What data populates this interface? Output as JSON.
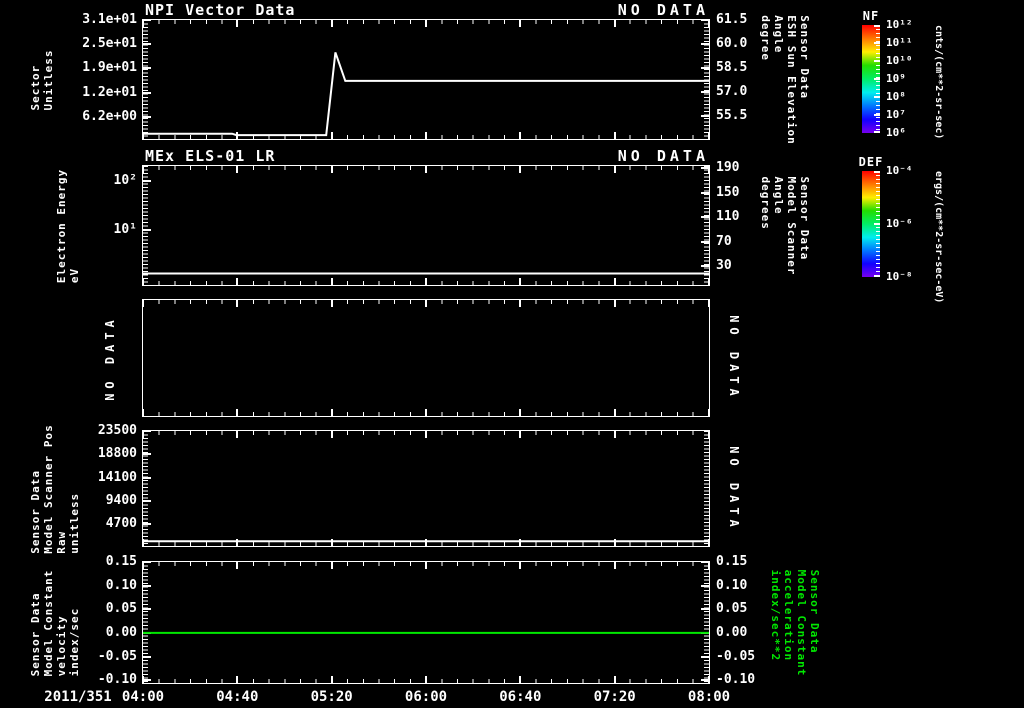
{
  "figure": {
    "background": "#000000",
    "foreground": "#ffffff",
    "accent_green": "#00e800"
  },
  "xaxis": {
    "date_label": "2011/351",
    "labels": [
      "04:00",
      "04:40",
      "05:20",
      "06:00",
      "06:40",
      "07:20",
      "08:00"
    ],
    "start_hour": 4,
    "end_hour": 8
  },
  "chart_data": [
    {
      "type": "line",
      "title": "NPI Vector Data",
      "status": "NO DATA",
      "left_label_lines": [
        "Sector",
        "Unitless"
      ],
      "right_label_lines": [
        "Sensor Data",
        "ESH Sun Elevation",
        "Angle",
        "degree"
      ],
      "y_rulers": true,
      "left_axis": {
        "min": 0.5,
        "max": 31.0,
        "log": false,
        "ticks": [
          {
            "v": 31.0,
            "label": "3.1e+01"
          },
          {
            "v": 24.8,
            "label": "2.5e+01"
          },
          {
            "v": 18.6,
            "label": "1.9e+01"
          },
          {
            "v": 12.4,
            "label": "1.2e+01"
          },
          {
            "v": 6.2,
            "label": "6.2e+00"
          }
        ]
      },
      "right_axis": {
        "min": 54.1,
        "max": 61.5,
        "log": false,
        "ticks": [
          {
            "v": 61.5,
            "label": "61.5"
          },
          {
            "v": 60.0,
            "label": "60.0"
          },
          {
            "v": 58.5,
            "label": "58.5"
          },
          {
            "v": 57.0,
            "label": "57.0"
          },
          {
            "v": 55.5,
            "label": "55.5"
          }
        ]
      },
      "series": [
        {
          "name": "npi-sector-trace",
          "color": "#ffffff",
          "points": [
            [
              4.0,
              1.85
            ],
            [
              4.63,
              1.85
            ],
            [
              4.66,
              1.5
            ],
            [
              5.295,
              1.5
            ],
            [
              5.36,
              22.7
            ],
            [
              5.43,
              15.4
            ],
            [
              8.0,
              15.4
            ]
          ]
        }
      ]
    },
    {
      "type": "line",
      "title": "MEx ELS-01 LR",
      "status": "NO DATA",
      "left_label_lines": [
        "Electron Energy",
        "eV"
      ],
      "right_label_lines": [
        "Sensor Data",
        "Model Scanner",
        "Angle",
        "degrees"
      ],
      "y_rulers": true,
      "left_axis": {
        "min": 0.76,
        "max": 200,
        "log": true,
        "ticks": [
          {
            "v": 100,
            "label": "10²"
          },
          {
            "v": 10,
            "label": "10¹"
          }
        ]
      },
      "right_axis": {
        "min": -0.4,
        "max": 193.2,
        "log": false,
        "ticks": [
          {
            "v": 190,
            "label": "190"
          },
          {
            "v": 150,
            "label": "150"
          },
          {
            "v": 110,
            "label": "110"
          },
          {
            "v": 70,
            "label": "70"
          },
          {
            "v": 30,
            "label": "30"
          }
        ]
      },
      "series": [
        {
          "name": "electron-energy-floor-trace",
          "color": "#ffffff",
          "points": [
            [
              4.0,
              1.3
            ],
            [
              8.0,
              1.3
            ]
          ]
        }
      ]
    },
    {
      "type": "empty",
      "left_label_lines": [
        "NO DATA"
      ],
      "right_label_lines": [
        "NO DATA"
      ],
      "y_rulers": false,
      "series": []
    },
    {
      "type": "line",
      "left_label_lines": [
        "Sensor Data",
        "Model Scanner Pos",
        "Raw",
        "unitless"
      ],
      "right_label_lines": [
        "NO DATA"
      ],
      "y_rulers": true,
      "left_axis": {
        "min": 340,
        "max": 23500,
        "log": false,
        "ticks": [
          {
            "v": 23500,
            "label": "23500"
          },
          {
            "v": 18800,
            "label": "18800"
          },
          {
            "v": 14100,
            "label": "14100"
          },
          {
            "v": 9400,
            "label": "9400"
          },
          {
            "v": 4700,
            "label": "4700"
          }
        ]
      },
      "series": [
        {
          "name": "scanner-pos-raw-trace",
          "color": "#ffffff",
          "points": [
            [
              4.0,
              1300
            ],
            [
              8.0,
              1300
            ]
          ]
        }
      ]
    },
    {
      "type": "line",
      "left_label_lines": [
        "Sensor Data",
        "Model Constant",
        "velocity",
        "index/sec"
      ],
      "right_label_lines": [
        "Sensor Data",
        "Model Constant",
        "acceleration",
        "index/sec**2"
      ],
      "right_label_color": "#00e800",
      "y_rulers": true,
      "show_x_labels": true,
      "left_axis": {
        "min": -0.106,
        "max": 0.15,
        "log": false,
        "ticks": [
          {
            "v": 0.15,
            "label": "0.15"
          },
          {
            "v": 0.1,
            "label": "0.10"
          },
          {
            "v": 0.05,
            "label": "0.05"
          },
          {
            "v": 0.0,
            "label": "0.00"
          },
          {
            "v": -0.05,
            "label": "-0.05"
          },
          {
            "v": -0.1,
            "label": "-0.10"
          }
        ]
      },
      "right_axis": {
        "min": -0.106,
        "max": 0.15,
        "log": false,
        "ticks": [
          {
            "v": 0.15,
            "label": "0.15"
          },
          {
            "v": 0.1,
            "label": "0.10"
          },
          {
            "v": 0.05,
            "label": "0.05"
          },
          {
            "v": 0.0,
            "label": "0.00"
          },
          {
            "v": -0.05,
            "label": "-0.05"
          },
          {
            "v": -0.1,
            "label": "-0.10"
          }
        ]
      },
      "series": [
        {
          "name": "model-constant-velocity-trace",
          "color": "#00e800",
          "points": [
            [
              4.0,
              0.0
            ],
            [
              8.0,
              0.0
            ]
          ]
        }
      ]
    }
  ],
  "colorbars": [
    {
      "title": "NF",
      "unit": "cnts/(cm**2-sr-sec)",
      "gradient": [
        "#ff0000",
        "#ff7700",
        "#ffee00",
        "#22dd00",
        "#00ee66",
        "#00eeee",
        "#0077ff",
        "#1100ff",
        "#7700ee"
      ],
      "ticks": [
        {
          "frac": 0.0,
          "label": "10¹²"
        },
        {
          "frac": 0.1667,
          "label": "10¹¹"
        },
        {
          "frac": 0.3333,
          "label": "10¹⁰"
        },
        {
          "frac": 0.5,
          "label": "10⁹"
        },
        {
          "frac": 0.6667,
          "label": "10⁸"
        },
        {
          "frac": 0.8333,
          "label": "10⁷"
        },
        {
          "frac": 1.0,
          "label": "10⁶"
        }
      ]
    },
    {
      "title": "DEF",
      "unit": "ergs/(cm**2-sr-sec-eV)",
      "gradient": [
        "#ff0000",
        "#ff7700",
        "#ffee00",
        "#22dd00",
        "#00ee66",
        "#00eeee",
        "#0077ff",
        "#1100ff",
        "#7700ee"
      ],
      "ticks": [
        {
          "frac": 0.0,
          "label": "10⁻⁴"
        },
        {
          "frac": 0.5,
          "label": "10⁻⁶"
        },
        {
          "frac": 1.0,
          "label": "10⁻⁸"
        }
      ]
    }
  ]
}
